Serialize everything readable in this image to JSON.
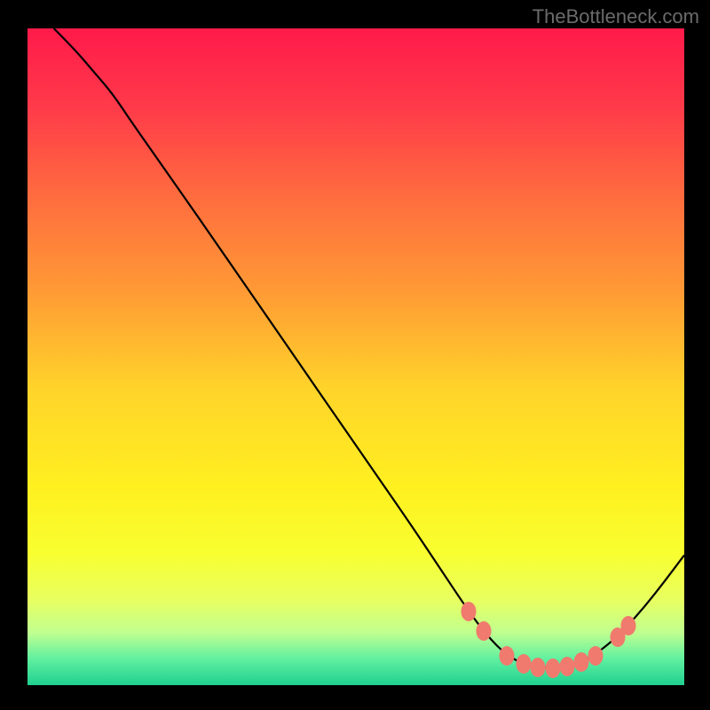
{
  "watermark": "TheBottleneck.com",
  "chart_data": {
    "type": "line",
    "title": "",
    "xlabel": "",
    "ylabel": "",
    "xlim": [
      0,
      100
    ],
    "ylim": [
      0,
      100
    ],
    "curve": [
      {
        "x": 4.0,
        "y": 100.0
      },
      {
        "x": 7.0,
        "y": 97.0
      },
      {
        "x": 10.0,
        "y": 93.5
      },
      {
        "x": 13.0,
        "y": 90.0
      },
      {
        "x": 16.0,
        "y": 85.5
      },
      {
        "x": 22.0,
        "y": 77.0
      },
      {
        "x": 30.0,
        "y": 65.5
      },
      {
        "x": 40.0,
        "y": 51.0
      },
      {
        "x": 50.0,
        "y": 36.5
      },
      {
        "x": 58.0,
        "y": 25.0
      },
      {
        "x": 63.0,
        "y": 17.5
      },
      {
        "x": 67.0,
        "y": 11.5
      },
      {
        "x": 70.0,
        "y": 7.5
      },
      {
        "x": 73.0,
        "y": 4.5
      },
      {
        "x": 76.0,
        "y": 3.0
      },
      {
        "x": 79.0,
        "y": 2.6
      },
      {
        "x": 82.0,
        "y": 2.9
      },
      {
        "x": 85.0,
        "y": 3.8
      },
      {
        "x": 88.0,
        "y": 5.8
      },
      {
        "x": 91.0,
        "y": 8.6
      },
      {
        "x": 94.0,
        "y": 12.0
      },
      {
        "x": 97.0,
        "y": 15.8
      },
      {
        "x": 100.0,
        "y": 19.8
      }
    ],
    "markers": [
      {
        "x": 67.1,
        "y": 11.2
      },
      {
        "x": 69.4,
        "y": 8.2
      },
      {
        "x": 73.0,
        "y": 4.4
      },
      {
        "x": 75.5,
        "y": 3.3
      },
      {
        "x": 77.7,
        "y": 2.7
      },
      {
        "x": 80.0,
        "y": 2.6
      },
      {
        "x": 82.2,
        "y": 2.9
      },
      {
        "x": 84.3,
        "y": 3.5
      },
      {
        "x": 86.5,
        "y": 4.5
      },
      {
        "x": 89.8,
        "y": 7.3
      },
      {
        "x": 91.5,
        "y": 9.1
      }
    ],
    "gradient_stops": [
      {
        "offset": 0.0,
        "color": "#ff1a4a"
      },
      {
        "offset": 0.12,
        "color": "#ff3a4a"
      },
      {
        "offset": 0.25,
        "color": "#ff6a3f"
      },
      {
        "offset": 0.4,
        "color": "#ff9a35"
      },
      {
        "offset": 0.55,
        "color": "#ffd42a"
      },
      {
        "offset": 0.7,
        "color": "#fff020"
      },
      {
        "offset": 0.8,
        "color": "#f8ff30"
      },
      {
        "offset": 0.87,
        "color": "#e8ff60"
      },
      {
        "offset": 0.92,
        "color": "#c0ff90"
      },
      {
        "offset": 0.96,
        "color": "#60f0a0"
      },
      {
        "offset": 1.0,
        "color": "#20d090"
      }
    ]
  }
}
